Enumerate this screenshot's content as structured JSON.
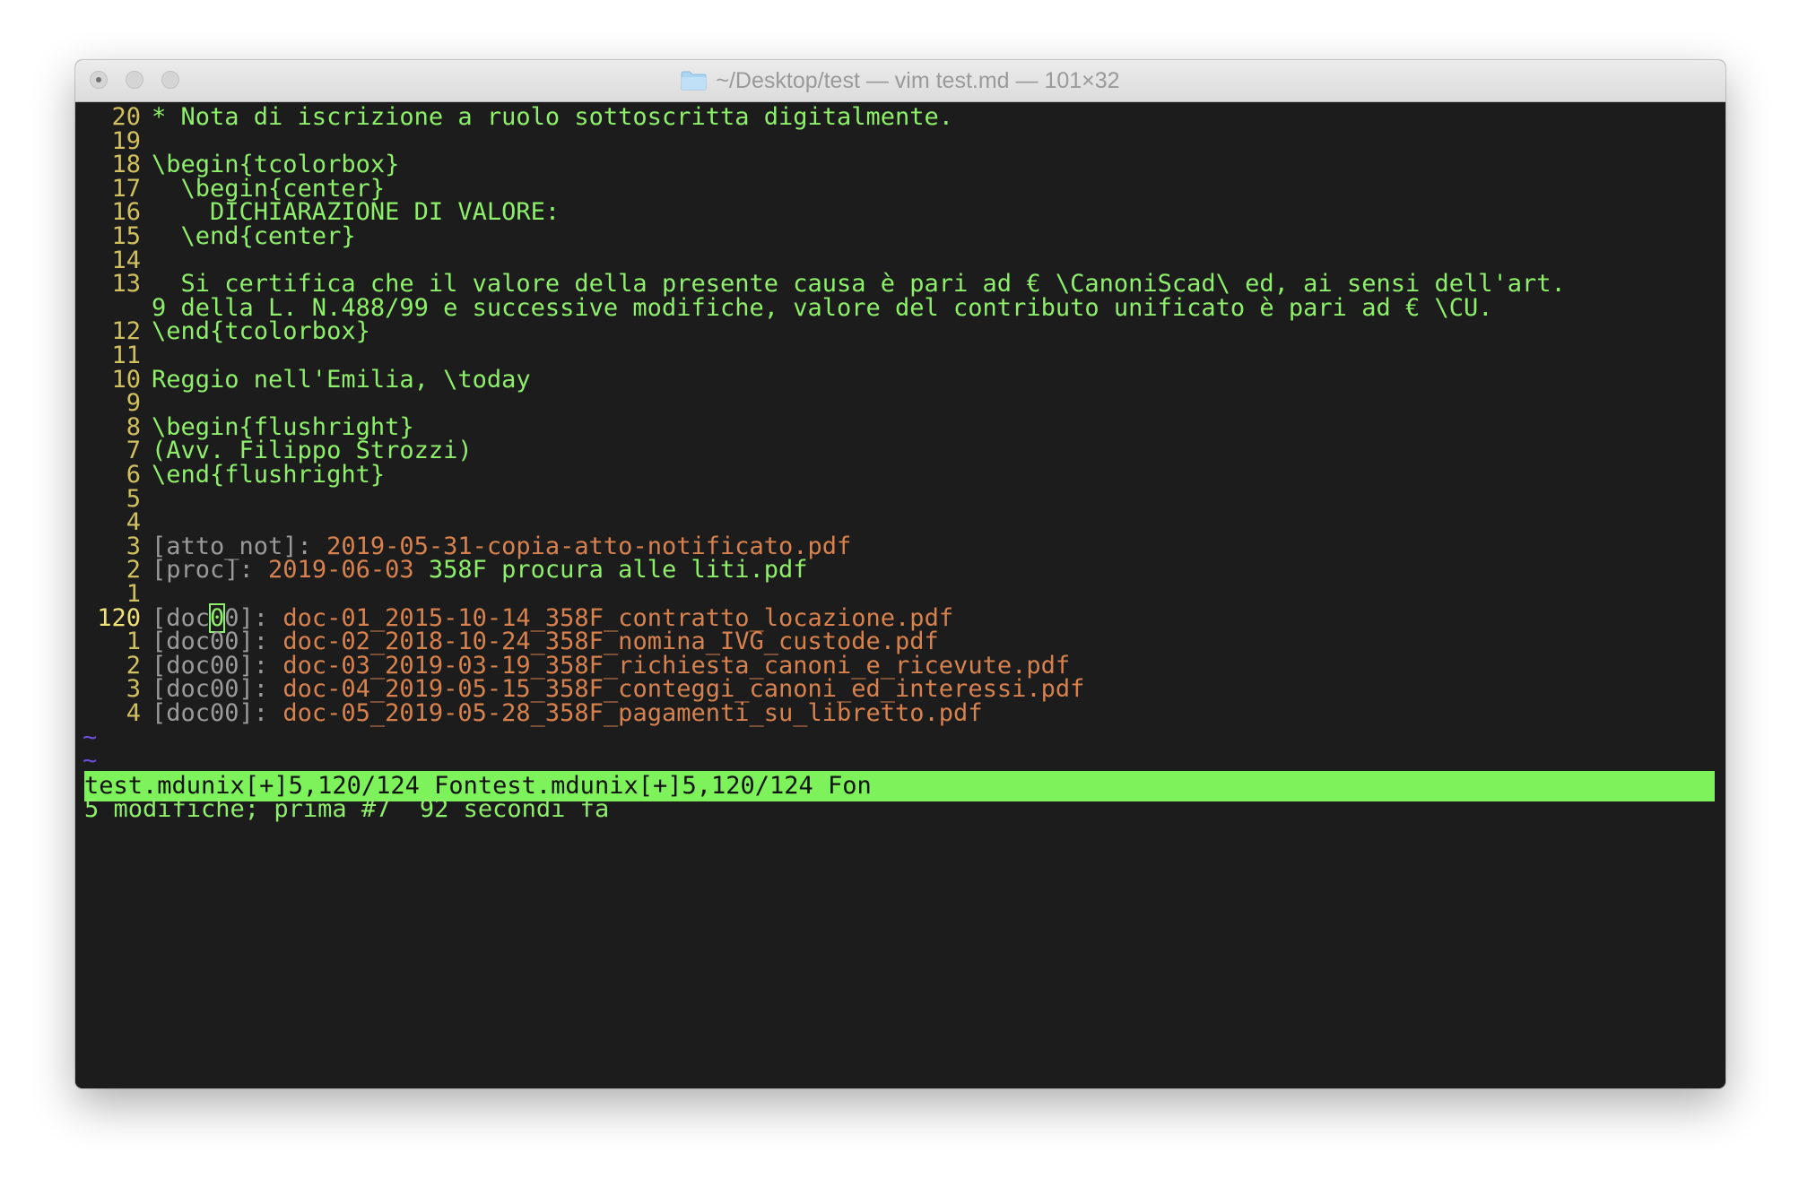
{
  "window": {
    "title": "~/Desktop/test — vim test.md — 101×32"
  },
  "editor": {
    "lines": [
      {
        "num": "20",
        "text": "* Nota di iscrizione a ruolo sottoscritta digitalmente."
      },
      {
        "num": "19",
        "text": ""
      },
      {
        "num": "18",
        "text": "\\begin{tcolorbox}"
      },
      {
        "num": "17",
        "text": "  \\begin{center}"
      },
      {
        "num": "16",
        "text": "    DICHIARAZIONE DI VALORE:"
      },
      {
        "num": "15",
        "text": "  \\end{center}"
      },
      {
        "num": "14",
        "text": ""
      },
      {
        "num": "13",
        "text": "  Si certifica che il valore della presente causa è pari ad € \\CanoniScad\\ ed, ai sensi dell'art."
      },
      {
        "num": "",
        "text": "9 della L. N.488/99 e successive modifiche, valore del contributo unificato è pari ad € \\CU."
      },
      {
        "num": "12",
        "text": "\\end{tcolorbox}"
      },
      {
        "num": "11",
        "text": ""
      },
      {
        "num": "10",
        "text": "Reggio nell'Emilia, \\today"
      },
      {
        "num": "9",
        "text": ""
      },
      {
        "num": "8",
        "text": "\\begin{flushright}"
      },
      {
        "num": "7",
        "text": "(Avv. Filippo Strozzi)"
      },
      {
        "num": "6",
        "text": "\\end{flushright}"
      },
      {
        "num": "5",
        "text": ""
      },
      {
        "num": "4",
        "text": ""
      }
    ],
    "links": [
      {
        "num": "3",
        "label": "[atto_not]: ",
        "target": "2019-05-31-copia-atto-notificato.pdf",
        "rest": ""
      },
      {
        "num": "2",
        "label": "[proc]: ",
        "target": "2019-06-03",
        "rest": " 358F procura alle liti.pdf"
      },
      {
        "num": "1",
        "label": "",
        "target": "",
        "rest": ""
      }
    ],
    "current_line": {
      "num": "120",
      "label_pre": "[doc",
      "cursor_char": "0",
      "label_post": "0]: ",
      "target": "doc-01_2015-10-14_358F_contratto_locazione.pdf"
    },
    "doc_lines": [
      {
        "num": "1",
        "label": "[doc00]: ",
        "target": "doc-02_2018-10-24_358F_nomina_IVG_custode.pdf"
      },
      {
        "num": "2",
        "label": "[doc00]: ",
        "target": "doc-03_2019-03-19_358F_richiesta_canoni_e_ricevute.pdf"
      },
      {
        "num": "3",
        "label": "[doc00]: ",
        "target": "doc-04_2019-05-15_358F_conteggi_canoni_ed_interessi.pdf"
      },
      {
        "num": "4",
        "label": "[doc00]: ",
        "target": "doc-05_2019-05-28_358F_pagamenti_su_libretto.pdf"
      }
    ],
    "tildes": [
      "~",
      "~"
    ]
  },
  "statusline": "test.mdunix[+]5,120/124 Fontest.mdunix[+]5,120/124 Fon",
  "message": "5 modifiche; prima #7  92 secondi fa",
  "colors": {
    "text": "#8ef06a",
    "line_number": "#d0c060",
    "link_target": "#d7824e",
    "statusline_bg": "#7ef25a",
    "tilde": "#6a4fd8"
  }
}
